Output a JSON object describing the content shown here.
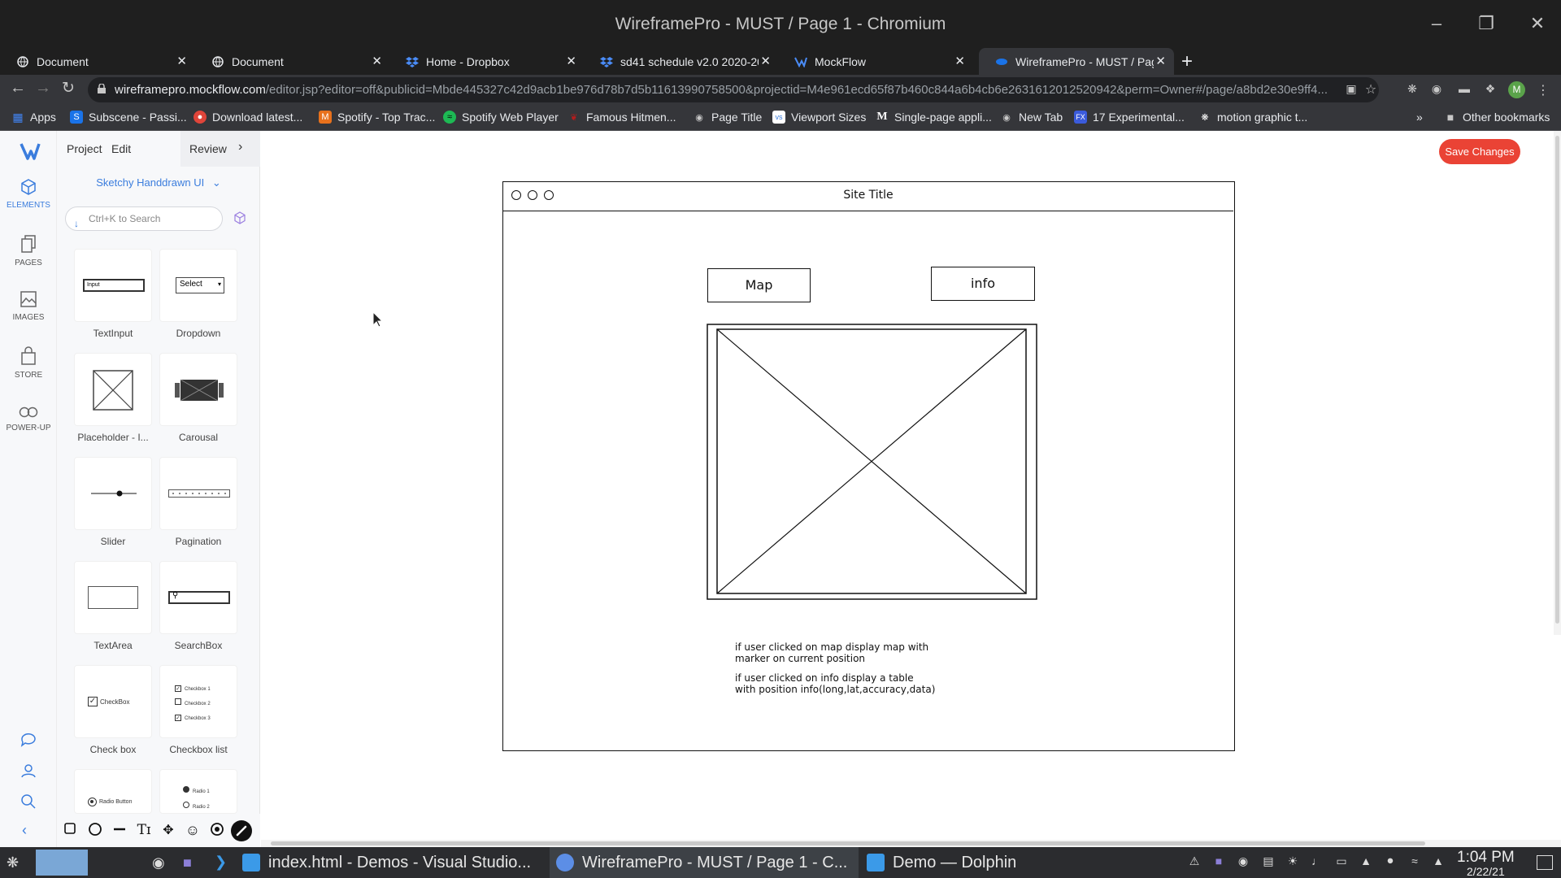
{
  "window": {
    "title": "WireframePro - MUST / Page 1 - Chromium"
  },
  "tabs": [
    {
      "label": "Document",
      "icon": "globe-icon"
    },
    {
      "label": "Document",
      "icon": "globe-icon"
    },
    {
      "label": "Home - Dropbox",
      "icon": "dropbox-icon"
    },
    {
      "label": "sd41 schedule v2.0 2020-2021",
      "icon": "dropbox-icon"
    },
    {
      "label": "MockFlow",
      "icon": "mockflow-icon"
    },
    {
      "label": "WireframePro - MUST / Page",
      "icon": "wireframepro-icon"
    }
  ],
  "address_bar": {
    "domain": "wireframepro.mockflow.com",
    "path": "/editor.jsp?editor=off&publicid=Mbde445327c42d9acb1be976d78b7d5b11613990758500&projectid=M4e961ecd65f87b460c844a6b4cb6e2631612012520942&perm=Owner#/page/a8bd2e30e9ff4..."
  },
  "profile_initial": "M",
  "bookmarks": [
    {
      "label": "Apps",
      "icon": "apps-grid-icon",
      "color": "#4285f4"
    },
    {
      "label": "Subscene - Passi...",
      "icon": "subscene-icon",
      "color": "#1a73e8"
    },
    {
      "label": "Download latest...",
      "icon": "download-icon",
      "color": "#e0453a"
    },
    {
      "label": "Spotify - Top Trac...",
      "icon": "m-icon",
      "color": "#e8711c"
    },
    {
      "label": "Spotify Web Player",
      "icon": "spotify-icon",
      "color": "#1db954"
    },
    {
      "label": "Famous Hitmen...",
      "icon": "hitmen-icon",
      "color": "#b71c1c"
    },
    {
      "label": "Page Title",
      "icon": "globe-icon",
      "color": "#9aa0a6"
    },
    {
      "label": "Viewport Sizes",
      "icon": "vs-icon",
      "color": "#3b7ddd"
    },
    {
      "label": "Single-page appli...",
      "icon": "medium-icon",
      "color": "#ffffff"
    },
    {
      "label": "New Tab",
      "icon": "globe-icon",
      "color": "#9aa0a6"
    },
    {
      "label": "17 Experimental...",
      "icon": "fx-icon",
      "color": "#3b5bdb"
    },
    {
      "label": "motion graphic t...",
      "icon": "motion-icon",
      "color": "#ffffff"
    }
  ],
  "other_bookmarks": "Other bookmarks",
  "editor": {
    "menu": {
      "project": "Project",
      "edit": "Edit",
      "review": "Review"
    },
    "rail": [
      {
        "label": "ELEMENTS",
        "icon": "cube-icon"
      },
      {
        "label": "PAGES",
        "icon": "pages-icon"
      },
      {
        "label": "IMAGES",
        "icon": "image-icon"
      },
      {
        "label": "STORE",
        "icon": "bag-icon"
      },
      {
        "label": "POWER-UP",
        "icon": "infinity-icon"
      }
    ],
    "theme": "Sketchy Handdrawn UI",
    "search_placeholder": "Ctrl+K to Search",
    "elements": [
      {
        "label": "TextInput",
        "preview": "Input"
      },
      {
        "label": "Dropdown",
        "preview": "Select"
      },
      {
        "label": "Placeholder - I..."
      },
      {
        "label": "Carousal"
      },
      {
        "label": "Slider"
      },
      {
        "label": "Pagination"
      },
      {
        "label": "TextArea"
      },
      {
        "label": "SearchBox"
      },
      {
        "label": "Check box",
        "preview": "CheckBox"
      },
      {
        "label": "Checkbox list",
        "preview_items": [
          "Checkbox 1",
          "Checkbox 2",
          "Checkbox 3"
        ]
      },
      {
        "preview": "Radio Button"
      },
      {
        "preview_items": [
          "Radio 1",
          "Radio 2"
        ]
      }
    ],
    "save_label": "Save Changes",
    "accent_color": "#3b7ddd",
    "save_color": "#ea4335"
  },
  "wireframe": {
    "site_title": "Site Title",
    "buttons": {
      "map": "Map",
      "info": "info"
    },
    "notes": [
      "if user clicked on map display map with",
      "marker on current position",
      "if user clicked on info display  a table",
      "with position info(long,lat,accuracy,data)"
    ]
  },
  "taskbar": {
    "items": [
      {
        "label": "index.html - Demos - Visual Studio...",
        "icon": "vscode-icon"
      },
      {
        "label": "WireframePro - MUST / Page 1 - C...",
        "icon": "chromium-icon"
      },
      {
        "label": "Demo — Dolphin",
        "icon": "folder-icon"
      }
    ],
    "time": "1:04 PM",
    "date": "2/22/21"
  }
}
